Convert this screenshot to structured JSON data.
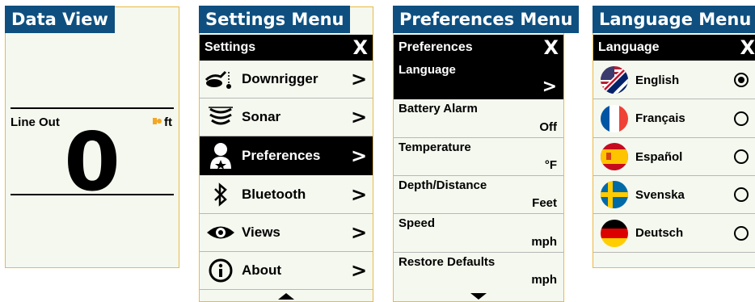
{
  "data_view": {
    "tab_title": "Data View",
    "label": "Line Out",
    "unit": "ft",
    "value": "0"
  },
  "settings": {
    "tab_title": "Settings Menu",
    "header": "Settings",
    "close": "X",
    "items": [
      {
        "label": "Downrigger",
        "icon": "downrigger-icon",
        "chevron": ">"
      },
      {
        "label": "Sonar",
        "icon": "sonar-icon",
        "chevron": ">"
      },
      {
        "label": "Preferences",
        "icon": "user-star-icon",
        "chevron": ">"
      },
      {
        "label": "Bluetooth",
        "icon": "bluetooth-icon",
        "chevron": ">"
      },
      {
        "label": "Views",
        "icon": "eye-icon",
        "chevron": ">"
      },
      {
        "label": "About",
        "icon": "info-icon",
        "chevron": ">"
      }
    ],
    "selected": "Preferences"
  },
  "preferences": {
    "tab_title": "Preferences Menu",
    "header": "Preferences",
    "close": "X",
    "items": [
      {
        "label": "Language",
        "value": ">"
      },
      {
        "label": "Battery Alarm",
        "value": "Off"
      },
      {
        "label": "Temperature",
        "value": "°F"
      },
      {
        "label": "Depth/Distance",
        "value": "Feet"
      },
      {
        "label": "Speed",
        "value": "mph"
      },
      {
        "label": "Restore Defaults",
        "value": "mph"
      }
    ],
    "selected": "Language"
  },
  "language": {
    "tab_title": "Language Menu",
    "header": "Language",
    "close": "X",
    "items": [
      {
        "label": "English",
        "flag": "us-uk-flag-icon",
        "checked": true
      },
      {
        "label": "Français",
        "flag": "france-flag-icon",
        "checked": false
      },
      {
        "label": "Español",
        "flag": "spain-flag-icon",
        "checked": false
      },
      {
        "label": "Svenska",
        "flag": "sweden-flag-icon",
        "checked": false
      },
      {
        "label": "Deutsch",
        "flag": "germany-flag-icon",
        "checked": false
      }
    ]
  },
  "colors": {
    "tab_blue": "#0e4f80",
    "screen_border": "#e9b949",
    "screen_bg": "#f4f8ee",
    "unit_orange": "#f5a623"
  }
}
